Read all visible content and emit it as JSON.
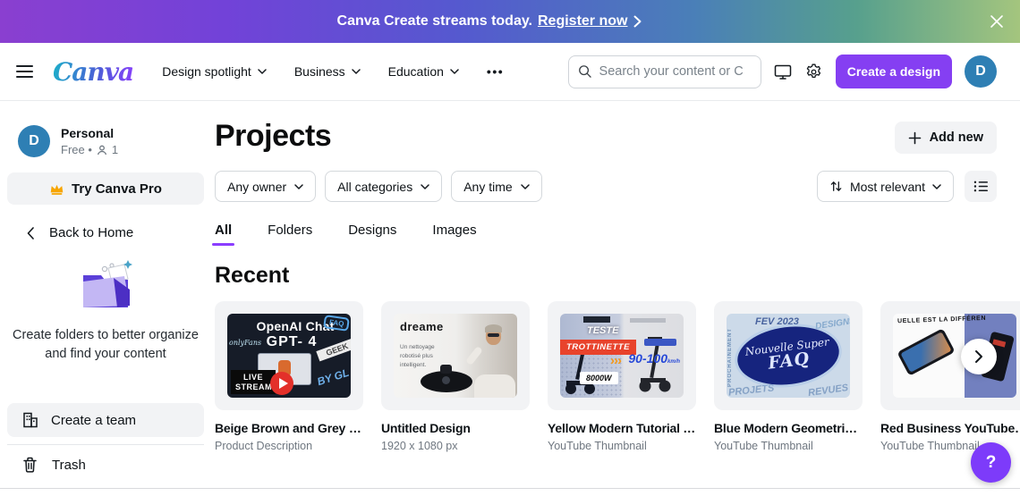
{
  "banner": {
    "message": "Canva Create streams today.",
    "link_label": "Register now"
  },
  "header": {
    "logo_text": "Canva",
    "nav": [
      {
        "label": "Design spotlight"
      },
      {
        "label": "Business"
      },
      {
        "label": "Education"
      }
    ],
    "more_label": "•••",
    "search_placeholder": "Search your content or C",
    "create_button_label": "Create a design",
    "avatar_initial": "D",
    "accent_color": "#853ff2"
  },
  "sidebar": {
    "profile": {
      "initial": "D",
      "name": "Personal",
      "plan": "Free •",
      "members": "1"
    },
    "pro_button_label": "Try Canva Pro",
    "back_label": "Back to Home",
    "empty_caption": "Create folders to better organize and find your content",
    "team_button_label": "Create a team",
    "trash_label": "Trash"
  },
  "main": {
    "title": "Projects",
    "add_button_label": "Add new",
    "filters": [
      {
        "label": "Any owner"
      },
      {
        "label": "All categories"
      },
      {
        "label": "Any time"
      }
    ],
    "sort_label": "Most relevant",
    "tabs": [
      {
        "label": "All"
      },
      {
        "label": "Folders"
      },
      {
        "label": "Designs"
      },
      {
        "label": "Images"
      }
    ],
    "section_title": "Recent",
    "cards": [
      {
        "title": "Beige Brown and Grey Co...",
        "subtitle": "Product Description",
        "thumb": {
          "line1": "OpenAI Chat",
          "line2": "GPT- 4",
          "fans": "onlyFans",
          "bubble": "FAQ",
          "geek": "GEEK",
          "by": "BY GL",
          "live": "LIVE STREAM"
        }
      },
      {
        "title": "Untitled Design",
        "subtitle": "1920 x 1080 px",
        "thumb": {
          "brand": "dreame",
          "caption": "Un nettoyage robotisé plus intelligent."
        }
      },
      {
        "title": "Yellow Modern Tutorial Y...",
        "subtitle": "YouTube Thumbnail",
        "thumb": {
          "teste": "TESTE",
          "label": "TROTTINETTE",
          "power": "8000W",
          "arrows": "›››",
          "speed": "90-100",
          "speed_unit": "km/h"
        }
      },
      {
        "title": "Blue Modern Geometric ...",
        "subtitle": "YouTube Thumbnail",
        "thumb": {
          "date": "FEV 2023",
          "wm_right": "DESIGNS",
          "wm_left": "PROCHAINEMENT",
          "wm_bottom_left": "PROJETS",
          "wm_bottom_right": "REVUES",
          "script": "Nouvelle Super",
          "big": "FAQ"
        }
      },
      {
        "title": "Red Business YouTube Th...",
        "subtitle": "YouTube Thumbnail",
        "thumb": {
          "top_text": "UELLE EST LA DIFFÉREN"
        }
      }
    ]
  },
  "floating": {
    "help_label": "?"
  }
}
